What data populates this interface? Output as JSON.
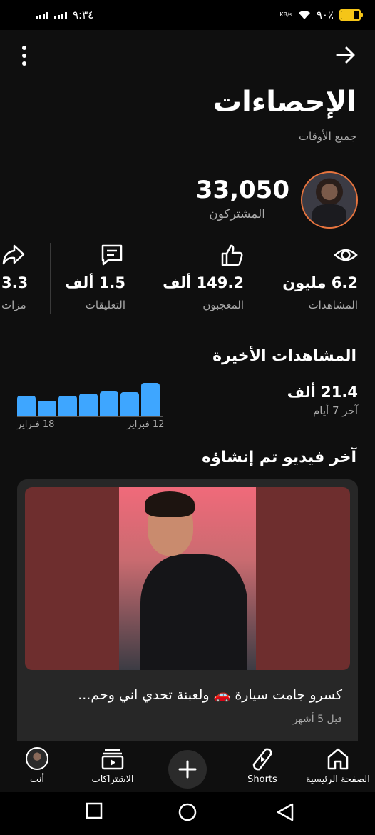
{
  "status_bar": {
    "time": "٩:٣٤",
    "network_speed": "KB/s",
    "battery": "٩٠٪"
  },
  "header": {
    "title": "الإحصاءات",
    "subtitle": "جميع الأوقات",
    "menu_icon": "more-vert-icon",
    "back_icon": "arrow-forward-icon"
  },
  "channel": {
    "subscribers": "33,050",
    "subscribers_label": "المشتركون"
  },
  "stats": [
    {
      "icon": "eye-icon",
      "value": "6.2 مليون",
      "label": "المشاهدات"
    },
    {
      "icon": "thumbs-up-icon",
      "value": "149.2 ألف",
      "label": "المعجبون"
    },
    {
      "icon": "comment-icon",
      "value": "1.5 ألف",
      "label": "التعليقات"
    },
    {
      "icon": "share-icon",
      "value": "3.3",
      "label": "مزات"
    }
  ],
  "recent_views": {
    "title": "المشاهدات الأخيرة",
    "value": "21.4 ألف",
    "period": "آخر 7 أيام",
    "bar_values": [
      0.55,
      0.42,
      0.55,
      0.62,
      0.68,
      0.65,
      0.9
    ],
    "start_label": "12 فبراير",
    "end_label": "18 فبراير",
    "bar_color": "#3ea6ff"
  },
  "latest_video": {
    "section_title": "آخر فيديو تم إنشاؤه",
    "title": "كسرو جامت سيارة 🚗 ولعبنة تحدي اني وحم...",
    "time": "قبل 5 أشهر"
  },
  "bottom_nav": [
    {
      "label": "الصفحة الرئيسية",
      "icon": "home-icon"
    },
    {
      "label": "Shorts",
      "icon": "shorts-icon"
    },
    {
      "label": "",
      "icon": "plus-icon"
    },
    {
      "label": "الاشتراكات",
      "icon": "subscriptions-icon"
    },
    {
      "label": "أنت",
      "icon": "avatar"
    }
  ],
  "system_nav": [
    "recents-icon",
    "home-circle-icon",
    "back-triangle-icon"
  ],
  "colors": {
    "background": "#0f0f0f",
    "accent_blue": "#3ea6ff",
    "secondary_text": "#aaaaaa",
    "card": "#272727"
  }
}
